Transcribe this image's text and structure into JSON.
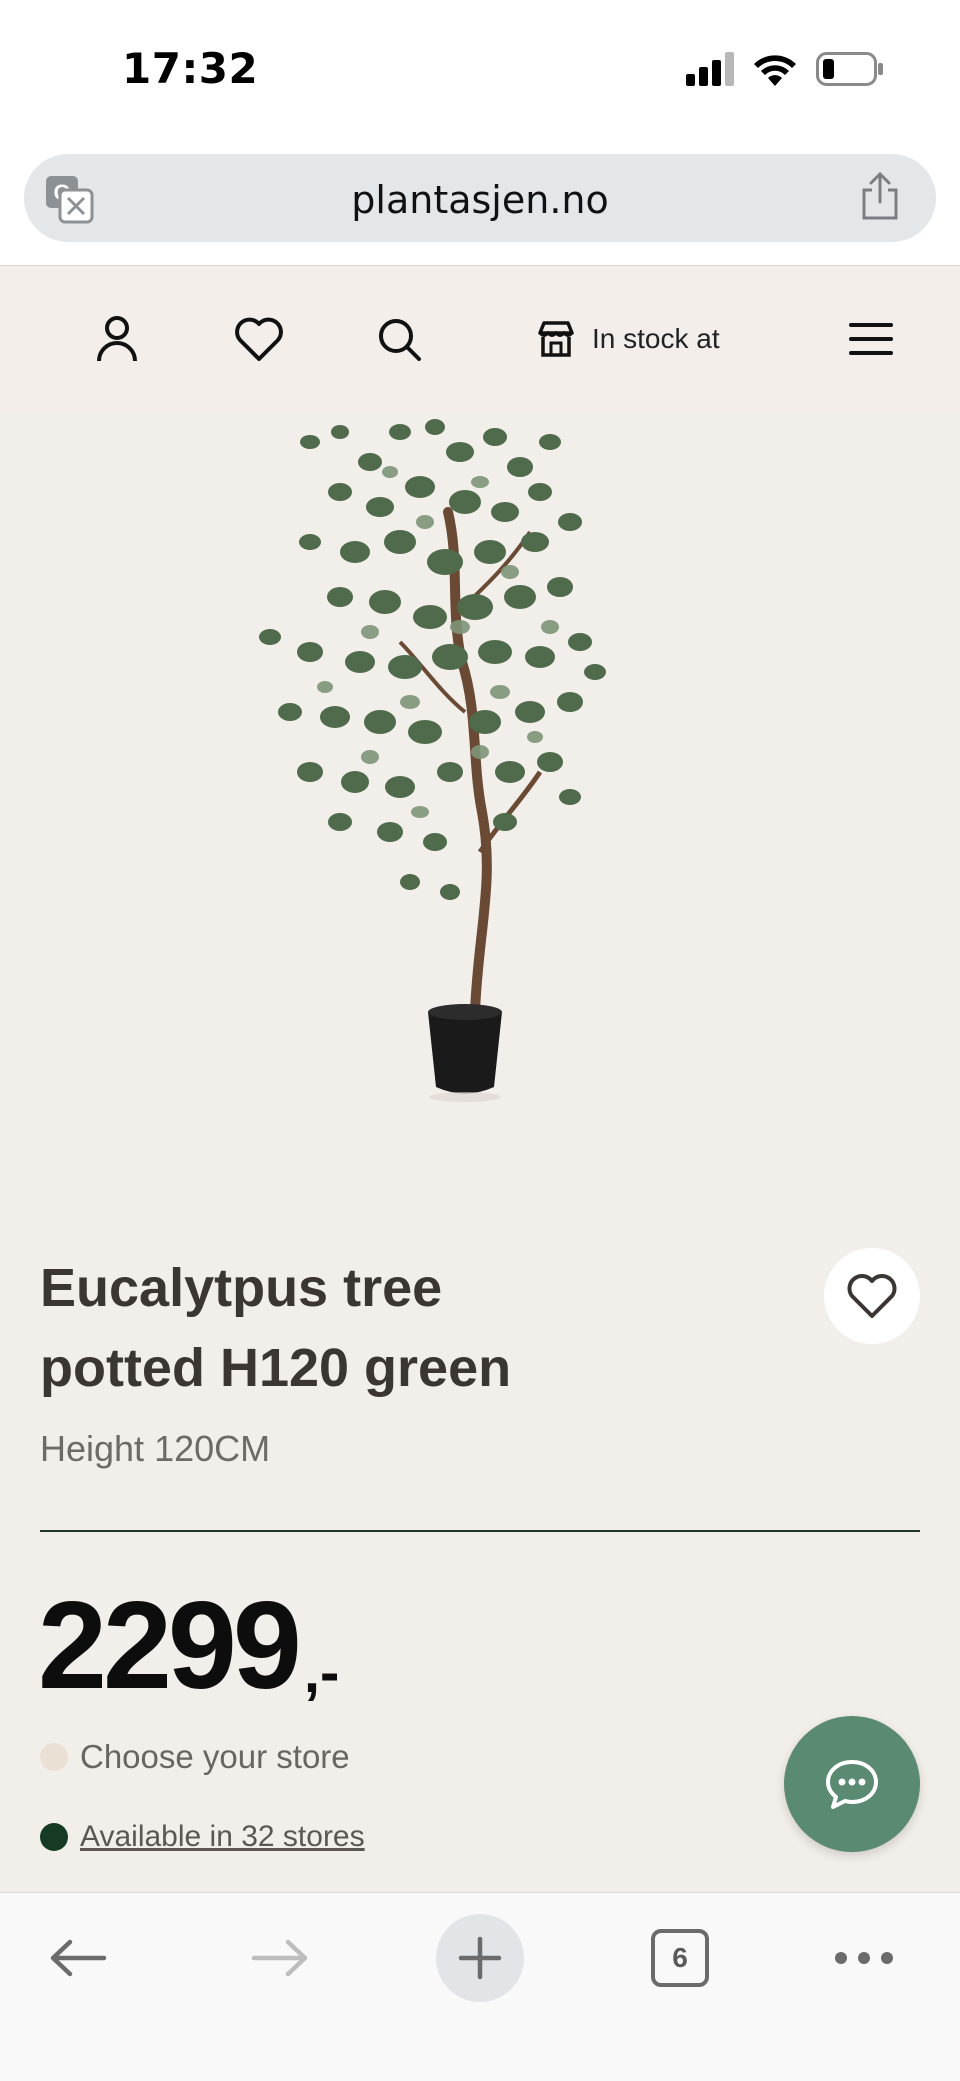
{
  "status_bar": {
    "time": "17:32",
    "icons": [
      "cellular-signal-icon",
      "wifi-icon",
      "battery-icon"
    ]
  },
  "browser": {
    "url": "plantasjen.no",
    "icons": [
      "translate-icon",
      "share-icon"
    ]
  },
  "site_header": {
    "icons": [
      "account-icon",
      "favorites-heart-icon",
      "search-icon",
      "store-icon",
      "menu-icon"
    ],
    "stock_label": "In stock at"
  },
  "product": {
    "image_alt": "eucalyptus-tree-potted-image",
    "title_line1": "Eucalytpus tree",
    "title_line2": "potted H120 green",
    "height_text": "Height 120CM",
    "price": "2299",
    "price_suffix": ",-",
    "store_select_text": "Choose your store",
    "availability_text": "Available in 32 stores",
    "colors": {
      "store_dot": "#eae1d4",
      "available_dot": "#153b25",
      "divider": "#1f3a2b",
      "chat_button": "#5b8a72"
    }
  },
  "bottom_toolbar": {
    "icons": [
      "back-arrow-icon",
      "forward-arrow-icon",
      "new-tab-plus-icon",
      "tabs-icon",
      "more-icon"
    ],
    "tab_count": "6"
  }
}
